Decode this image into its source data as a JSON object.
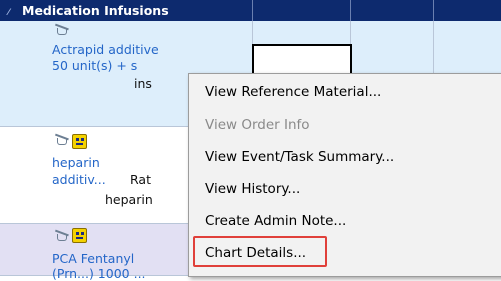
{
  "section": {
    "title": "Medication Infusions",
    "collapse_glyph": "⁄"
  },
  "orders": [
    {
      "line1": "Actrapid additive",
      "line2": "50 unit(s) + s",
      "line3": "ins"
    },
    {
      "line1": "heparin",
      "line2": "additiv...",
      "line2b": "Rat",
      "line3": "heparin"
    },
    {
      "line1": "PCA Fentanyl",
      "line2": "(Prn...) 1000 ..."
    }
  ],
  "context_menu": {
    "items": [
      {
        "label": "View Reference Material...",
        "enabled": true
      },
      {
        "label": "View Order Info",
        "enabled": false
      },
      {
        "label": "View Event/Task Summary...",
        "enabled": true
      },
      {
        "label": "View History...",
        "enabled": true
      },
      {
        "label": "Create Admin Note...",
        "enabled": true
      },
      {
        "label": "Chart Details...",
        "enabled": true,
        "highlighted": true
      }
    ]
  },
  "colors": {
    "header_bg": "#0d2a6e",
    "row_selected_bg": "#ddeefb",
    "row_alt_bg": "#e2e0f3",
    "link": "#2466c8",
    "highlight_border": "#e0403a"
  }
}
